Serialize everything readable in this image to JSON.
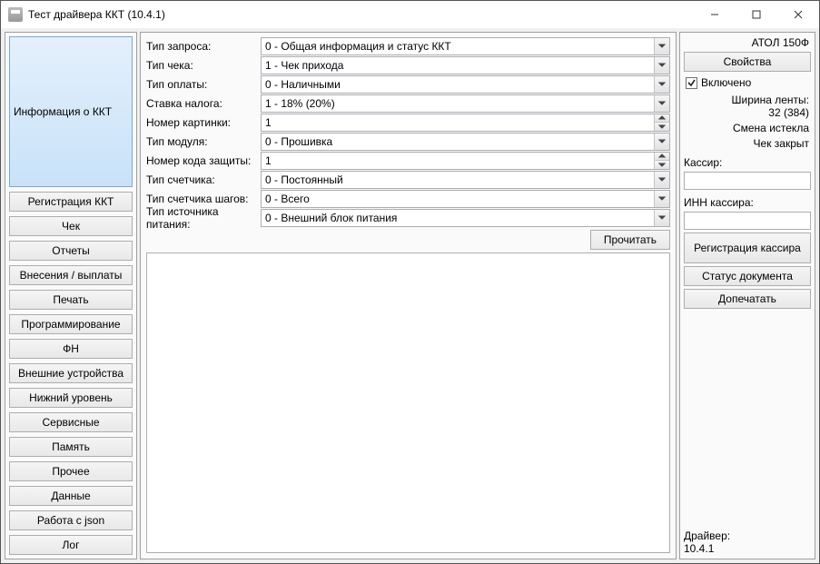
{
  "title": "Тест драйвера ККТ (10.4.1)",
  "nav": {
    "items": [
      "Информация о ККТ",
      "Регистрация ККТ",
      "Чек",
      "Отчеты",
      "Внесения / выплаты",
      "Печать",
      "Программирование",
      "ФН",
      "Внешние устройства",
      "Нижний уровень",
      "Сервисные",
      "Память",
      "Прочее",
      "Данные",
      "Работа с json",
      "Лог"
    ],
    "selected_index": 0
  },
  "form": {
    "rows": {
      "request_type": {
        "label": "Тип запроса:",
        "value": "0 - Общая информация и статус ККТ",
        "kind": "select"
      },
      "check_type": {
        "label": "Тип чека:",
        "value": "1 - Чек прихода",
        "kind": "select"
      },
      "pay_type": {
        "label": "Тип оплаты:",
        "value": "0 - Наличными",
        "kind": "select"
      },
      "tax_rate": {
        "label": "Ставка налога:",
        "value": "1 - 18% (20%)",
        "kind": "select"
      },
      "pic_num": {
        "label": "Номер картинки:",
        "value": "1",
        "kind": "spin"
      },
      "module_type": {
        "label": "Тип модуля:",
        "value": "0 - Прошивка",
        "kind": "select"
      },
      "prot_code_num": {
        "label": "Номер кода защиты:",
        "value": "1",
        "kind": "spin"
      },
      "counter_type": {
        "label": "Тип счетчика:",
        "value": "0 - Постоянный",
        "kind": "select"
      },
      "step_counter": {
        "label": "Тип счетчика шагов:",
        "value": "0 - Всего",
        "kind": "select"
      },
      "power_type": {
        "label": "Тип источника питания:",
        "value": "0 - Внешний блок питания",
        "kind": "select"
      }
    },
    "read_btn": "Прочитать"
  },
  "side": {
    "device": "АТОЛ 150Ф",
    "props_btn": "Свойства",
    "enabled_chk": "Включено",
    "tape": {
      "label": "Ширина ленты:",
      "value": "32 (384)"
    },
    "shift": "Смена истекла",
    "check": "Чек закрыт",
    "cashier_label": "Кассир:",
    "cashier_value": "",
    "inn_label": "ИНН кассира:",
    "inn_value": "",
    "reg_btn": "Регистрация кассира",
    "doc_status_btn": "Статус документа",
    "reprint_btn": "Допечатать",
    "driver_label": "Драйвер:",
    "driver_ver": "10.4.1"
  }
}
